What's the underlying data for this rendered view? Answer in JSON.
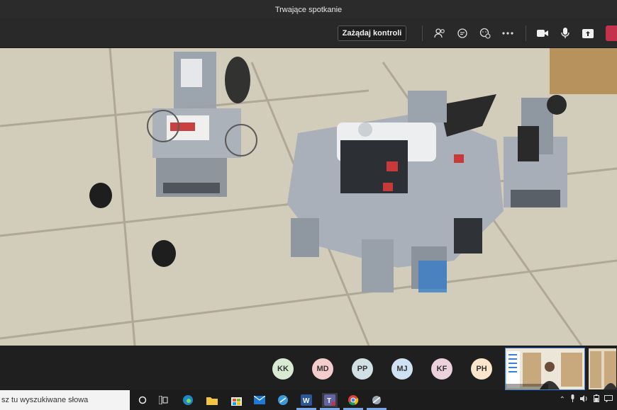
{
  "window": {
    "title": "Trwające spotkanie"
  },
  "toolbar": {
    "request_control_label": "Zażądaj kontroli"
  },
  "participants": [
    {
      "initials": "KK",
      "color": "#d9ead3"
    },
    {
      "initials": "MD",
      "color": "#f4cccc"
    },
    {
      "initials": "PP",
      "color": "#d0e0e3"
    },
    {
      "initials": "MJ",
      "color": "#cfe2f3"
    },
    {
      "initials": "KF",
      "color": "#ead1dc"
    },
    {
      "initials": "PH",
      "color": "#fce5cd"
    }
  ],
  "taskbar": {
    "search_placeholder": "sz tu wyszukiwane słowa"
  },
  "colors": {
    "accent": "#6264a7",
    "leave": "#c4314b"
  }
}
